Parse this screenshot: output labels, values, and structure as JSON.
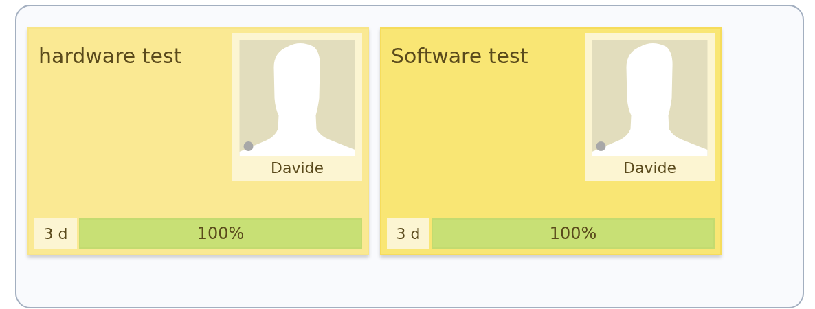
{
  "cards": [
    {
      "title": "hardware test",
      "selected": false,
      "assignee": "Davide",
      "duration": "3 d",
      "progress": "100%",
      "level": 1
    },
    {
      "title": "Software test",
      "selected": true,
      "assignee": "Davide",
      "duration": "3 d",
      "progress": "100%",
      "level": 1
    }
  ]
}
